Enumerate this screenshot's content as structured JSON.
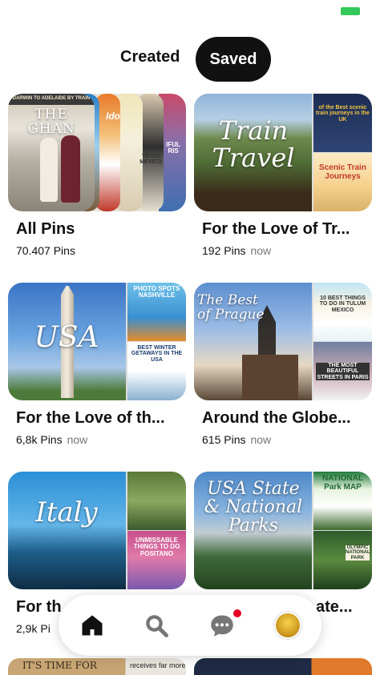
{
  "status_bar": {
    "battery_color": "#34c759"
  },
  "tabs": {
    "created": "Created",
    "saved": "Saved"
  },
  "boards": [
    {
      "title": "All Pins",
      "pins": "70.407 Pins",
      "ago": "",
      "cover_texts": {
        "banner": "DARWIN TO ADELAIDE BY TRAIN",
        "headline": "THE GHAN",
        "side_a": "Ido",
        "side_b": "TO DO MEXICO",
        "side_c": "IFUL RIS"
      }
    },
    {
      "title": "For the Love of Tr...",
      "pins": "192 Pins",
      "ago": "now",
      "cover_texts": {
        "main": "Train Travel",
        "side1": "of the Best scenic train journeys in the UK",
        "side2": "Scenic Train Journeys"
      }
    },
    {
      "title": "For the Love of th...",
      "pins": "6,8k Pins",
      "ago": "now",
      "cover_texts": {
        "main": "USA",
        "side1": "PHOTO SPOTS NASHVILLE",
        "side2": "BEST WINTER GETAWAYS IN THE USA"
      }
    },
    {
      "title": "Around the Globe...",
      "pins": "615 Pins",
      "ago": "now",
      "cover_texts": {
        "main": "The Best of Prague",
        "side1": "10 BEST THINGS TO DO IN TULUM MEXICO",
        "side2": "THE MOST BEAUTIFUL STREETS IN PARIS"
      }
    },
    {
      "title": "For th",
      "pins": "2,9k Pi",
      "ago": "",
      "cover_texts": {
        "main": "Italy",
        "side2": "UNMISSABLE THINGS TO DO POSITANO"
      }
    },
    {
      "title": "ate...",
      "pins": "",
      "ago": "",
      "cover_texts": {
        "main": "USA State & National Parks",
        "side1": "NATIONAL Park MAP",
        "side2": "OLYMPIC NATIONAL PARK"
      }
    }
  ],
  "peek": {
    "left_text": "IT'S TIME FOR",
    "mid_text": "receives far more"
  },
  "nav": {
    "home": "home-icon",
    "search": "search-icon",
    "messages": "chat-icon",
    "profile": "avatar",
    "notification_color": "#e60023"
  }
}
